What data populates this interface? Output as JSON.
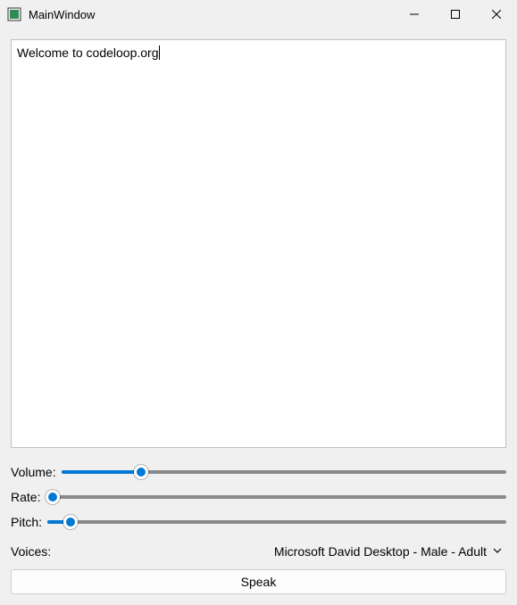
{
  "window": {
    "title": "MainWindow"
  },
  "text_input": {
    "value": "Welcome to codeloop.org"
  },
  "controls": {
    "volume": {
      "label": "Volume:",
      "percent": 18
    },
    "rate": {
      "label": "Rate:",
      "percent": 1.5
    },
    "pitch": {
      "label": "Pitch:",
      "percent": 5
    }
  },
  "voices": {
    "label": "Voices:",
    "selected": "Microsoft David Desktop - Male - Adult"
  },
  "speak_button": {
    "label": "Speak"
  }
}
